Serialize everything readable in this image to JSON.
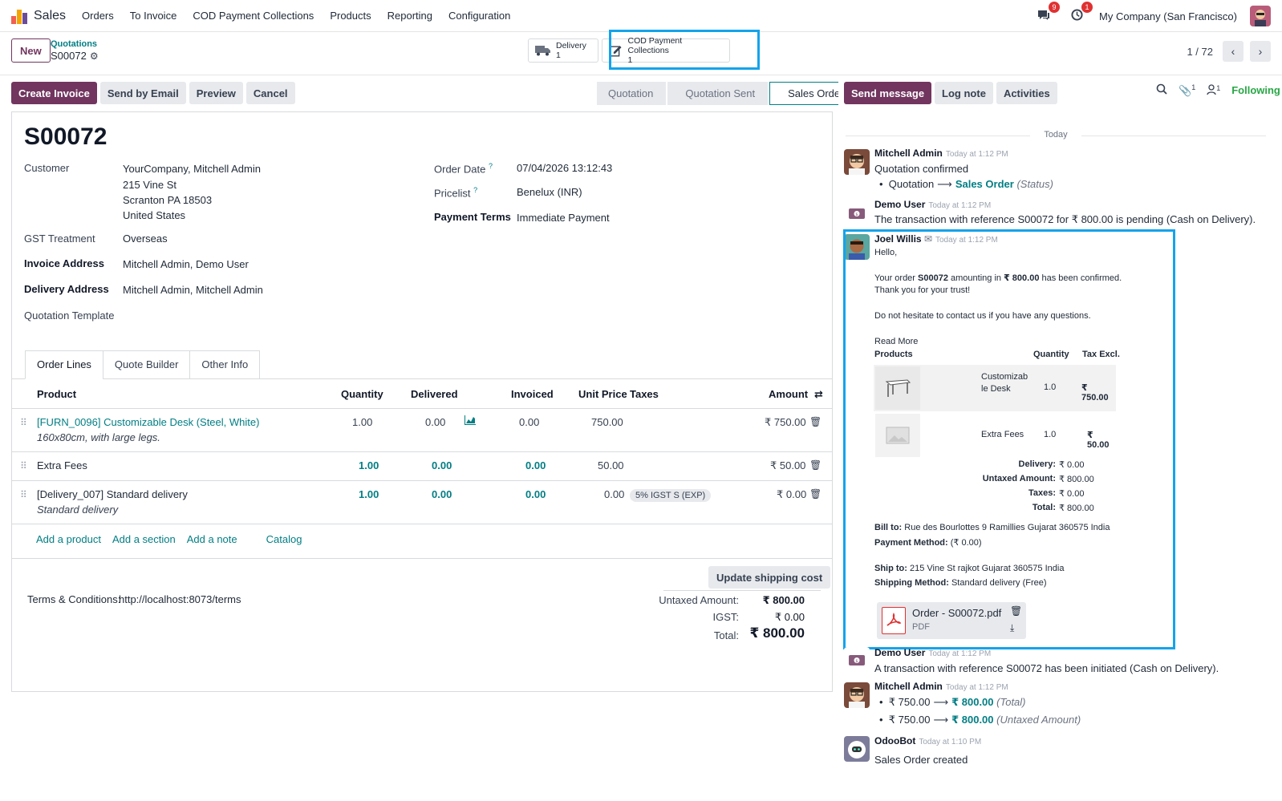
{
  "navbar": {
    "app_name": "Sales",
    "menu": [
      "Orders",
      "To Invoice",
      "COD Payment Collections",
      "Products",
      "Reporting",
      "Configuration"
    ],
    "messages_count": "9",
    "activities_count": "1",
    "company": "My Company (San Francisco)"
  },
  "control": {
    "new_label": "New",
    "breadcrumb_parent": "Quotations",
    "breadcrumb_current": "S00072",
    "smart_delivery_label": "Delivery",
    "smart_delivery_count": "1",
    "smart_cod_label": "COD Payment Collections",
    "smart_cod_count": "1",
    "pager": "1 / 72"
  },
  "actions": {
    "create_invoice": "Create Invoice",
    "send_email": "Send by Email",
    "preview": "Preview",
    "cancel": "Cancel"
  },
  "status": [
    "Quotation",
    "Quotation Sent",
    "Sales Order"
  ],
  "form": {
    "title": "S00072",
    "customer_label": "Customer",
    "customer_name": "YourCompany, Mitchell Admin",
    "customer_addr1": "215 Vine St",
    "customer_addr2": "Scranton PA 18503",
    "customer_addr3": "United States",
    "gst_label": "GST Treatment",
    "gst_value": "Overseas",
    "invoice_addr_label": "Invoice Address",
    "invoice_addr_value": "Mitchell Admin, Demo User",
    "delivery_addr_label": "Delivery Address",
    "delivery_addr_value": "Mitchell Admin, Mitchell Admin",
    "template_label": "Quotation Template",
    "order_date_label": "Order Date",
    "order_date_value": "07/04/2026 13:12:43",
    "pricelist_label": "Pricelist",
    "pricelist_value": "Benelux (INR)",
    "payment_terms_label": "Payment Terms",
    "payment_terms_value": "Immediate Payment",
    "help_mark": "?"
  },
  "tabs": [
    "Order Lines",
    "Quote Builder",
    "Other Info"
  ],
  "table": {
    "headers": {
      "product": "Product",
      "quantity": "Quantity",
      "delivered": "Delivered",
      "invoiced": "Invoiced",
      "unit_price": "Unit Price",
      "taxes": "Taxes",
      "amount": "Amount"
    },
    "rows": [
      {
        "product": "[FURN_0096] Customizable Desk (Steel, White)",
        "desc": "160x80cm, with large legs.",
        "quantity": "1.00",
        "delivered": "0.00",
        "invoiced": "0.00",
        "unit_price": "750.00",
        "taxes": "",
        "amount": "₹ 750.00"
      },
      {
        "product": "Extra Fees",
        "desc": "",
        "quantity": "1.00",
        "delivered": "0.00",
        "invoiced": "0.00",
        "unit_price": "50.00",
        "taxes": "",
        "amount": "₹ 50.00"
      },
      {
        "product": "[Delivery_007] Standard delivery",
        "desc": "Standard delivery",
        "quantity": "1.00",
        "delivered": "0.00",
        "invoiced": "0.00",
        "unit_price": "0.00",
        "taxes": "5% IGST S (EXP)",
        "amount": "₹ 0.00"
      }
    ],
    "add_product": "Add a product",
    "add_section": "Add a section",
    "add_note": "Add a note",
    "catalog": "Catalog"
  },
  "footer": {
    "update_shipping": "Update shipping cost",
    "terms_label": "Terms & Conditions:",
    "terms_link": "http://localhost:8073/terms",
    "untaxed_label": "Untaxed Amount:",
    "untaxed_value": "₹ 800.00",
    "igst_label": "IGST:",
    "igst_value": "₹ 0.00",
    "total_label": "Total:",
    "total_value": "₹ 800.00"
  },
  "chatter": {
    "send_message": "Send message",
    "log_note": "Log note",
    "activities": "Activities",
    "attachments_count": "1",
    "followers_count": "1",
    "following": "Following",
    "today": "Today",
    "messages": {
      "m1_author": "Mitchell Admin",
      "m1_date": "Today at 1:12 PM",
      "m1_text": "Quotation confirmed",
      "m1_from": "Quotation",
      "m1_to": "Sales Order",
      "m1_field": "(Status)",
      "m2_author": "Demo User",
      "m2_date": "Today at 1:12 PM",
      "m2_text": "The transaction with reference S00072 for ₹ 800.00 is pending (Cash on Delivery).",
      "m3_author": "Joel Willis",
      "m3_date": "Today at 1:12 PM",
      "m3_hello": "Hello,",
      "m3_line1_a": "Your order",
      "m3_line1_order": "S00072",
      "m3_line1_b": "amounting in",
      "m3_line1_amount": "₹ 800.00",
      "m3_line1_c": "has been confirmed.",
      "m3_line2": "Thank you for your trust!",
      "m3_line3": "Do not hesitate to contact us if you have any questions.",
      "m3_read_more": "Read More",
      "m3_col_products": "Products",
      "m3_col_quantity": "Quantity",
      "m3_col_tax": "Tax Excl.",
      "m3_p1_name_a": "Customizab",
      "m3_p1_name_b": "le Desk",
      "m3_p1_qty": "1.0",
      "m3_p1_price": "₹ 750.00",
      "m3_p2_name": "Extra Fees",
      "m3_p2_qty": "1.0",
      "m3_p2_price": "₹ 50.00",
      "m3_delivery_label": "Delivery:",
      "m3_delivery_value": "₹ 0.00",
      "m3_untaxed_label": "Untaxed Amount:",
      "m3_untaxed_value": "₹ 800.00",
      "m3_taxes_label": "Taxes:",
      "m3_taxes_value": "₹ 0.00",
      "m3_total_label": "Total:",
      "m3_total_value": "₹ 800.00",
      "m3_bill_label": "Bill to:",
      "m3_bill_value": "Rue des Bourlottes 9 Ramillies Gujarat 360575 India",
      "m3_paymethod_label": "Payment Method:",
      "m3_paymethod_value": "(₹ 0.00)",
      "m3_ship_label": "Ship to:",
      "m3_ship_value": "215 Vine St rajkot Gujarat 360575 India",
      "m3_shipmethod_label": "Shipping Method:",
      "m3_shipmethod_value": "Standard delivery (Free)",
      "m3_attachment_name": "Order - S00072.pdf",
      "m3_attachment_type": "PDF",
      "m4_author": "Demo User",
      "m4_date": "Today at 1:12 PM",
      "m4_text": "A transaction with reference S00072 has been initiated (Cash on Delivery).",
      "m5_author": "Mitchell Admin",
      "m5_date": "Today at 1:12 PM",
      "m5_l1_from": "₹ 750.00",
      "m5_l1_to": "₹ 800.00",
      "m5_l1_field": "(Total)",
      "m5_l2_from": "₹ 750.00",
      "m5_l2_to": "₹ 800.00",
      "m5_l2_field": "(Untaxed Amount)",
      "m6_author": "OdooBot",
      "m6_date": "Today at 1:10 PM",
      "m6_text": "Sales Order created"
    }
  },
  "colors": {
    "primary": "#71355f",
    "link": "#017e84",
    "highlight": "#14a3eb",
    "badge": "#e03131",
    "following": "#28a745"
  }
}
